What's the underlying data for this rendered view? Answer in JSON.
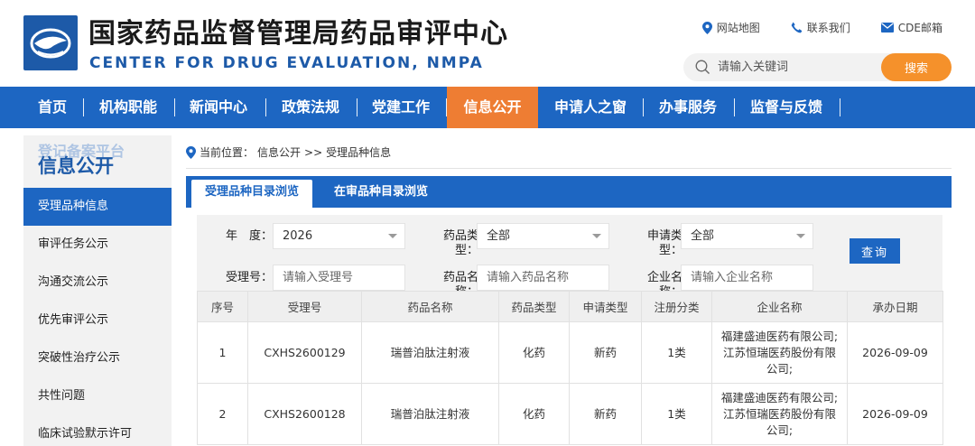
{
  "header": {
    "title_cn": "国家药品监督管理局药品审评中心",
    "title_en": "CENTER FOR DRUG EVALUATION, NMPA",
    "top_links": [
      {
        "label": "网站地图",
        "icon": "location-pin-icon"
      },
      {
        "label": "联系我们",
        "icon": "phone-icon"
      },
      {
        "label": "CDE邮箱",
        "icon": "mail-icon"
      }
    ],
    "search": {
      "placeholder": "请输入关键词",
      "button": "搜索"
    }
  },
  "nav": {
    "items": [
      "首页",
      "机构职能",
      "新闻中心",
      "政策法规",
      "党建工作",
      "信息公开",
      "申请人之窗",
      "办事服务",
      "监督与反馈"
    ],
    "active_index": 5
  },
  "sidebar": {
    "ghost_text": "登记备案平台",
    "heading": "信息公开",
    "items": [
      "受理品种信息",
      "审评任务公示",
      "沟通交流公示",
      "优先审评公示",
      "突破性治疗公示",
      "共性问题",
      "临床试验默示许可"
    ],
    "active_index": 0
  },
  "breadcrumb": {
    "prefix": "当前位置：",
    "parent": "信息公开",
    "separator": ">>",
    "current": "受理品种信息"
  },
  "tabs": {
    "items": [
      "受理品种目录浏览",
      "在审品种目录浏览"
    ],
    "active_index": 0
  },
  "filters": {
    "year_label": "年　度：",
    "year_value": "2026",
    "drug_type_label": "药品类型：",
    "drug_type_value": "全部",
    "apply_type_label": "申请类型：",
    "apply_type_value": "全部",
    "accept_no_label": "受理号：",
    "accept_no_placeholder": "请输入受理号",
    "drug_name_label": "药品名称：",
    "drug_name_placeholder": "请输入药品名称",
    "company_label": "企业名称：",
    "company_placeholder": "请输入企业名称",
    "query_button": "查询"
  },
  "table": {
    "columns": [
      "序号",
      "受理号",
      "药品名称",
      "药品类型",
      "申请类型",
      "注册分类",
      "企业名称",
      "承办日期"
    ],
    "rows": [
      [
        "1",
        "CXHS2600129",
        "瑞普泊肽注射液",
        "化药",
        "新药",
        "1类",
        "福建盛迪医药有限公司;江苏恒瑞医药股份有限公司;",
        "2026-09-09"
      ],
      [
        "2",
        "CXHS2600128",
        "瑞普泊肽注射液",
        "化药",
        "新药",
        "1类",
        "福建盛迪医药有限公司;江苏恒瑞医药股份有限公司;",
        "2026-09-09"
      ]
    ]
  },
  "colors": {
    "brand_blue": "#1d66c2",
    "accent_orange": "#ee7d33",
    "search_orange": "#f5912b"
  }
}
